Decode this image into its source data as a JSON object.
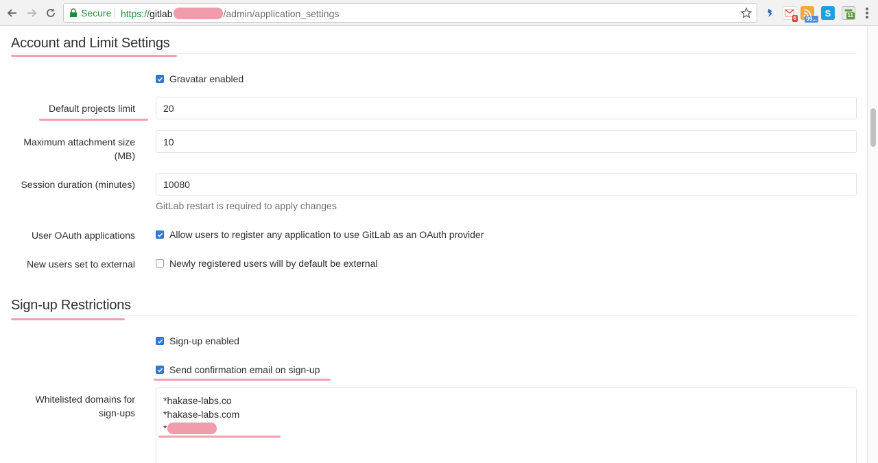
{
  "browser": {
    "secure_label": "Secure",
    "url_scheme": "https://",
    "url_host": "gitlab",
    "url_path": "/admin/application_settings",
    "extensions": [
      {
        "name": "pushbullet-icon",
        "color": "#2d6cc0"
      },
      {
        "name": "gmail-icon",
        "color": "#d44638",
        "badge": "6"
      },
      {
        "name": "rss-icon",
        "color": "#4f8fd9",
        "badge": "99..."
      },
      {
        "name": "skype-icon",
        "color": "#1ea0e0"
      },
      {
        "name": "calendar-icon",
        "color": "#5b9a3c",
        "badge": "11"
      }
    ]
  },
  "account_section": {
    "title": "Account and Limit Settings",
    "gravatar": {
      "label": "Gravatar enabled",
      "checked": true
    },
    "default_projects_limit": {
      "label": "Default projects limit",
      "value": "20"
    },
    "max_attachment_size": {
      "label_line1": "Maximum attachment size",
      "label_line2": "(MB)",
      "value": "10"
    },
    "session_duration": {
      "label": "Session duration (minutes)",
      "value": "10080",
      "help": "GitLab restart is required to apply changes"
    },
    "user_oauth": {
      "label": "User OAuth applications",
      "checkbox_label": "Allow users to register any application to use GitLab as an OAuth provider",
      "checked": true
    },
    "new_users_external": {
      "label": "New users set to external",
      "checkbox_label": "Newly registered users will by default be external",
      "checked": false
    }
  },
  "signup_section": {
    "title": "Sign-up Restrictions",
    "signup_enabled": {
      "label": "Sign-up enabled",
      "checked": true
    },
    "send_confirmation": {
      "label": "Send confirmation email on sign-up",
      "checked": true
    },
    "whitelist": {
      "label_line1": "Whitelisted domains for",
      "label_line2": "sign-ups",
      "lines": [
        "*hakase-labs.co",
        "*hakase-labs.com",
        "*"
      ]
    }
  },
  "colors": {
    "checkbox_accent": "#2f7bd6",
    "highlight": "#f0a0b0",
    "secure_green": "#1e8e3e"
  }
}
